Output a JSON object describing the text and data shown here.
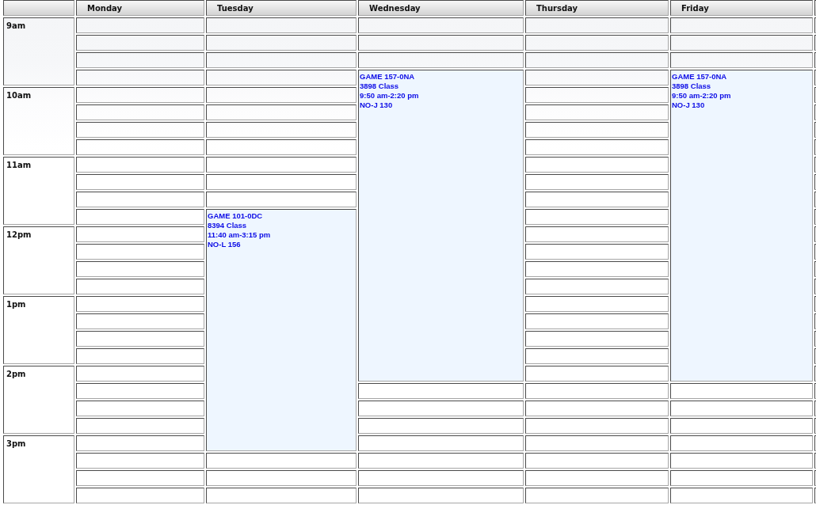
{
  "calendar": {
    "hours": [
      {
        "label": "9am"
      },
      {
        "label": "10am"
      },
      {
        "label": "11am"
      },
      {
        "label": "12pm"
      },
      {
        "label": "1pm"
      },
      {
        "label": "2pm"
      },
      {
        "label": "3pm"
      }
    ],
    "days": [
      {
        "name": "Monday"
      },
      {
        "name": "Tuesday",
        "events": [
          {
            "course": "GAME 101-0DC",
            "section": "8394 Class",
            "time": "11:40 am-3:15 pm",
            "room": "NO-L 156"
          }
        ]
      },
      {
        "name": "Wednesday",
        "events": [
          {
            "course": "GAME 157-0NA",
            "section": "3898 Class",
            "time": "9:50 am-2:20 pm",
            "room": "NO-J 130"
          }
        ]
      },
      {
        "name": "Thursday"
      },
      {
        "name": "Friday",
        "events": [
          {
            "course": "GAME 157-0NA",
            "section": "3898 Class",
            "time": "9:50 am-2:20 pm",
            "room": "NO-J 130"
          }
        ]
      }
    ]
  }
}
